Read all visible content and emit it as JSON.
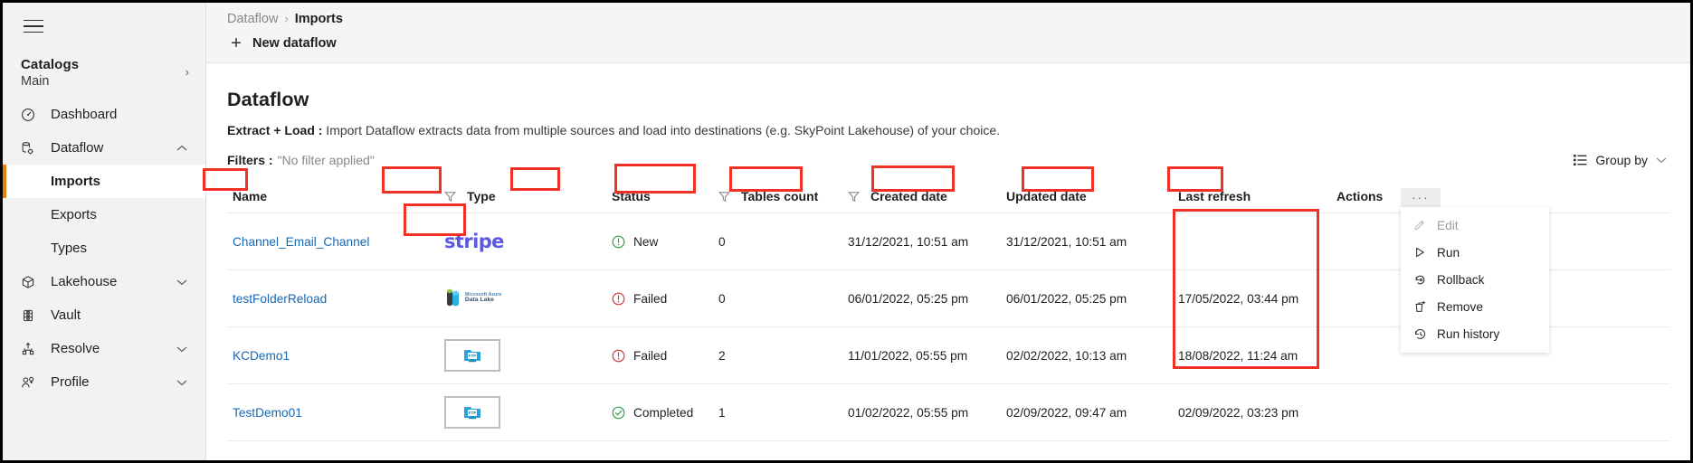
{
  "sidebar": {
    "hamburger_label": "menu",
    "catalogs": {
      "title": "Catalogs",
      "subtitle": "Main"
    },
    "items": [
      {
        "label": "Dashboard",
        "icon": "dashboard-icon",
        "expandable": false
      },
      {
        "label": "Dataflow",
        "icon": "dataflow-icon",
        "expandable": true,
        "expanded": true
      },
      {
        "label": "Lakehouse",
        "icon": "lakehouse-icon",
        "expandable": true,
        "expanded": false
      },
      {
        "label": "Vault",
        "icon": "vault-icon",
        "expandable": false
      },
      {
        "label": "Resolve",
        "icon": "resolve-icon",
        "expandable": true,
        "expanded": false
      },
      {
        "label": "Profile",
        "icon": "profile-icon",
        "expandable": true,
        "expanded": false
      }
    ],
    "dataflow_children": [
      {
        "label": "Imports",
        "active": true
      },
      {
        "label": "Exports",
        "active": false
      },
      {
        "label": "Types",
        "active": false
      }
    ]
  },
  "topbar": {
    "breadcrumb_root": "Dataflow",
    "breadcrumb_sep": "›",
    "breadcrumb_current": "Imports",
    "new_dataflow_label": "New dataflow",
    "new_dataflow_plus": "+"
  },
  "page": {
    "title": "Dataflow",
    "desc_bold": "Extract + Load :",
    "desc_text": " Import Dataflow extracts data from multiple sources and load into destinations (e.g. SkyPoint Lakehouse) of your choice.",
    "filters_label": "Filters :",
    "filters_value": "\"No filter applied\"",
    "group_by_label": "Group by"
  },
  "table": {
    "columns": [
      {
        "key": "name",
        "label": "Name",
        "has_filter": false
      },
      {
        "key": "type",
        "label": "Type",
        "has_filter": true
      },
      {
        "key": "status",
        "label": "Status",
        "has_filter": false
      },
      {
        "key": "tables",
        "label": "Tables count",
        "has_filter": true
      },
      {
        "key": "created",
        "label": "Created date",
        "has_filter": true
      },
      {
        "key": "updated",
        "label": "Updated date",
        "has_filter": false
      },
      {
        "key": "refresh",
        "label": "Last refresh",
        "has_filter": false
      },
      {
        "key": "actions",
        "label": "Actions",
        "has_filter": false
      }
    ],
    "rows": [
      {
        "name": "Channel_Email_Channel",
        "type_icon": "stripe-logo",
        "type_label": "stripe",
        "status": "New",
        "status_kind": "new",
        "tables_count": "0",
        "created": "31/12/2021, 10:51 am",
        "updated": "31/12/2021, 10:51 am",
        "refresh": ""
      },
      {
        "name": "testFolderReload",
        "type_icon": "azure-data-lake-logo",
        "type_label_1": "Microsoft Azure",
        "type_label_2": "Data Lake",
        "status": "Failed",
        "status_kind": "failed",
        "tables_count": "0",
        "created": "06/01/2022, 05:25 pm",
        "updated": "06/01/2022, 05:25 pm",
        "refresh": "17/05/2022, 03:44 pm"
      },
      {
        "name": "KCDemo1",
        "type_icon": "ftp-folder-icon",
        "status": "Failed",
        "status_kind": "failed",
        "tables_count": "2",
        "created": "11/01/2022, 05:55 pm",
        "updated": "02/02/2022, 10:13 am",
        "refresh": "18/08/2022, 11:24 am"
      },
      {
        "name": "TestDemo01",
        "type_icon": "ftp-folder-icon",
        "status": "Completed",
        "status_kind": "completed",
        "tables_count": "1",
        "created": "01/02/2022, 05:55 pm",
        "updated": "02/09/2022, 09:47 am",
        "refresh": "02/09/2022, 03:23 pm"
      }
    ]
  },
  "actions_menu": {
    "ellipsis": "···",
    "items": [
      {
        "label": "Edit",
        "icon": "pencil-icon",
        "disabled": true
      },
      {
        "label": "Run",
        "icon": "play-icon",
        "disabled": false
      },
      {
        "label": "Rollback",
        "icon": "undo-icon",
        "disabled": false
      },
      {
        "label": "Remove",
        "icon": "trash-icon",
        "disabled": false
      },
      {
        "label": "Run history",
        "icon": "history-icon",
        "disabled": false
      }
    ]
  },
  "colors": {
    "accent_orange": "#e8820c",
    "link_blue": "#1668b8",
    "status_failed": "#d13438",
    "status_completed": "#2f9e44",
    "status_new": "#2f9e44",
    "annotation_red": "#ee3124",
    "sidebar_bg": "#f3f2f1",
    "stripe_purple": "#5a5ae0"
  }
}
